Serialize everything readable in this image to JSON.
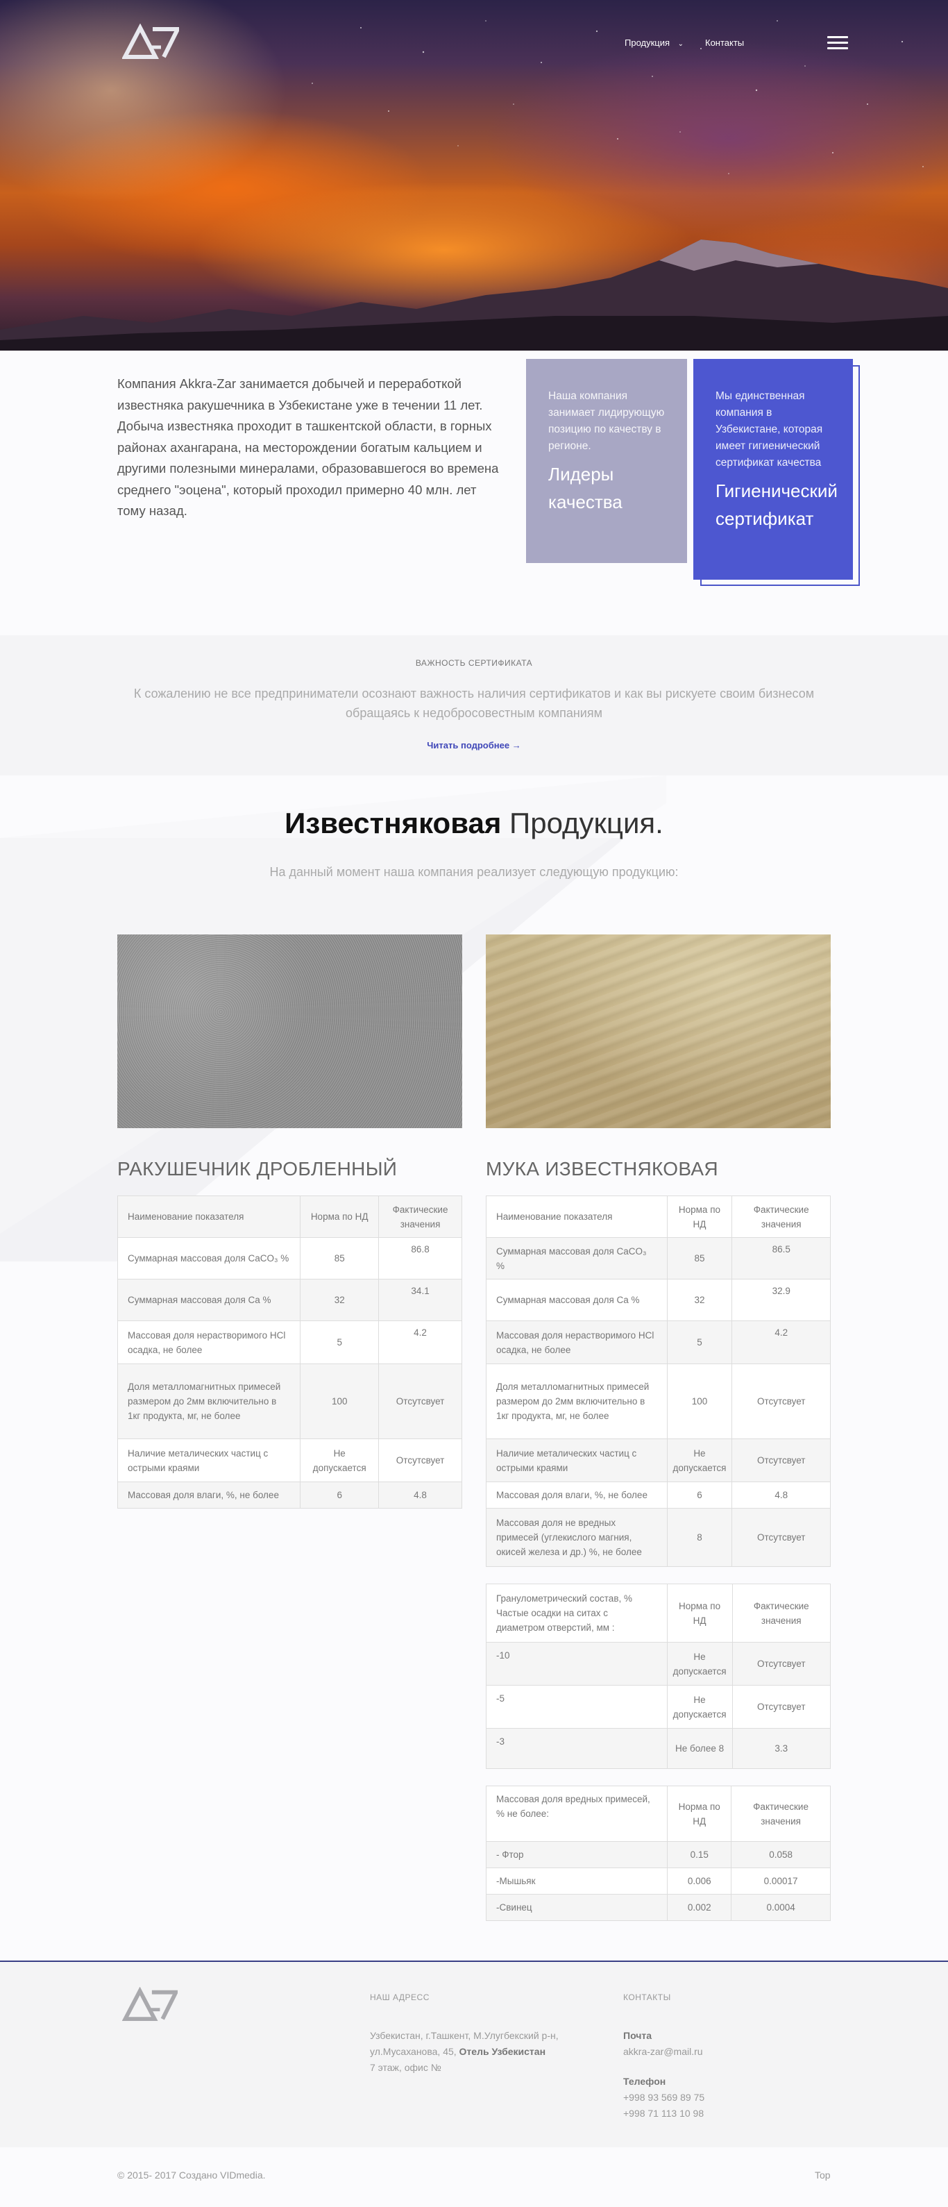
{
  "nav": {
    "products": "Продукция",
    "contacts": "Контакты"
  },
  "intro": {
    "text": "Компания Akkra-Zar занимается добычей и переработкой известняка ракушечника в Узбекистане уже в течении 11 лет. Добыча известняка проходит в ташкентской области, в горных районах ахангарана, на месторождении богатым кальцием и другими полезными минералами, образовавшегося во времена среднего \"эоцена\", который проходил примерно 40 млн. лет тому назад."
  },
  "cards": {
    "leaders": {
      "small": "Наша компания занимает лидирующую позицию по качеству в регионе.",
      "big": "Лидеры качества"
    },
    "certificate": {
      "small": "Мы единственная компания в Узбекистане, которая имеет гигиенический сертификат качества",
      "big": "Гигиенический сертификат"
    }
  },
  "cert_section": {
    "label": "ВАЖНОСТЬ СЕРТИФИКАТА",
    "body": "К сожалению не все предприниматели осознают важность наличия сертификатов и как вы рискуете своим бизнесом обращаясь к недобросовестным компаниям",
    "link": "Читать подробнее →"
  },
  "products": {
    "title_bold": "Известняковая",
    "title_light": "Продукция.",
    "subtitle": "На данный момент наша компания реализует следующую продукцию:",
    "left": {
      "heading": "РАКУШЕЧНИК ДРОБЛЕННЫЙ",
      "header": [
        "Наименование показателя",
        "Норма по НД",
        "Фактические значения"
      ],
      "rows": [
        [
          "Суммарная массовая доля CaCO₃ %",
          "85",
          "86.8"
        ],
        [
          "Суммарная массовая доля Ca %",
          "32",
          "34.1"
        ],
        [
          "Массовая доля нерастворимого HCl осадка, не более",
          "5",
          "4.2"
        ],
        [
          "Доля металломагнитных примесей размером до 2мм включительно в 1кг продукта, мг, не более",
          "100",
          "Отсутсвует"
        ],
        [
          "Наличие металических частиц с острыми краями",
          "Не допускается",
          "Отсутсвует"
        ],
        [
          "Массовая доля влаги, %, не более",
          "6",
          "4.8"
        ]
      ]
    },
    "right": {
      "heading": "МУКА ИЗВЕСТНЯКОВАЯ",
      "header": [
        "Наименование показателя",
        "Норма по НД",
        "Фактические значения"
      ],
      "rows": [
        [
          "Суммарная массовая доля CaCO₃ %",
          "85",
          "86.5"
        ],
        [
          "Суммарная массовая доля Ca %",
          "32",
          "32.9"
        ],
        [
          "Массовая доля нерастворимого HCl осадка, не более",
          "5",
          "4.2"
        ],
        [
          "Доля металломагнитных примесей размером до 2мм включительно в 1кг продукта, мг, не более",
          "100",
          "Отсутсвует"
        ],
        [
          "Наличие металических частиц с острыми краями",
          "Не допускается",
          "Отсутсвует"
        ],
        [
          "Массовая доля влаги, %, не более",
          "6",
          "4.8"
        ],
        [
          "Массовая доля не вредных примесей (углекислого магния, окисей железа и др.) %, не более",
          "8",
          "Отсутсвует"
        ]
      ],
      "granulo": {
        "header": [
          "Гранулометрический состав, % Частые осадки на ситах с диаметром отверстий, мм :",
          "Норма по НД",
          "Фактические значения"
        ],
        "rows": [
          [
            "-10",
            "Не допускается",
            "Отсутсвует"
          ],
          [
            "-5",
            "Не допускается",
            "Отсутсвует"
          ],
          [
            "-3",
            "Не более 8",
            "3.3"
          ]
        ]
      },
      "harmful": {
        "header": [
          "Массовая доля вредных примесей, % не более:",
          "Норма по НД",
          "Фактические значения"
        ],
        "rows": [
          [
            "- Фтор",
            "0.15",
            "0.058"
          ],
          [
            "-Мышьяк",
            "0.006",
            "0.00017"
          ],
          [
            "-Свинец",
            "0.002",
            "0.0004"
          ]
        ]
      }
    }
  },
  "footer": {
    "address_label": "НАШ АДРЕСС",
    "address_line1": "Узбекистан, г.Ташкент, М.Улугбекский р-н,",
    "address_line2_pre": "ул.Мусаханова, 45,",
    "address_line2_bold": "Отель Узбекистан",
    "address_line3": "7 этаж, офис №",
    "contacts_label": "КОНТАКТЫ",
    "mail_label": "Почта",
    "mail": "akkra-zar@mail.ru",
    "phone_label": "Телефон",
    "phone1": "+998 93 569 89 75",
    "phone2": "+998 71 113 10 98",
    "copyright": "© 2015- 2017 Создано VIDmedia.",
    "top": "Top"
  },
  "icons": {
    "logo": "akkra-zar-logo",
    "menu": "hamburger-icon",
    "dropdown": "chevron-down-icon"
  },
  "colors": {
    "accent": "#4d57d0",
    "card_grey": "#a8a7c4",
    "link": "#3f47b8"
  }
}
